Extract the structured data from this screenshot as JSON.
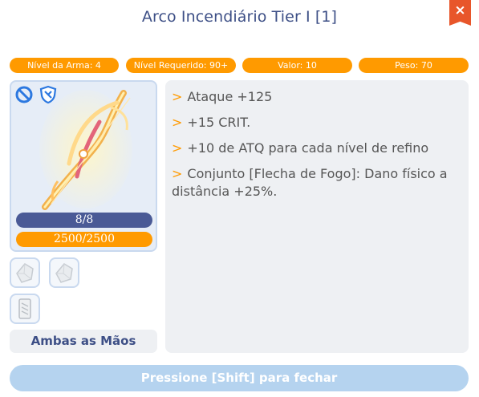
{
  "window": {
    "title": "Arco Incendiário Tier I [1]",
    "close_label": "×"
  },
  "colors": {
    "accent_orange": "#ff9a00",
    "title_blue": "#3d4f86",
    "close_red": "#e8562a",
    "durability_bar": "#4a5a96"
  },
  "stats": [
    {
      "label": "Nível da Arma: 4"
    },
    {
      "label": "Nível Requerido: 90+"
    },
    {
      "label": "Valor: 10"
    },
    {
      "label": "Peso: 70"
    }
  ],
  "item_panel": {
    "badges": [
      "no-trade-icon",
      "shield-icon"
    ],
    "image": "fire-bow-icon",
    "durability_text": "8/8",
    "exp_text": "2500/2500"
  },
  "slots": [
    {
      "icon": "crystal-slot-icon"
    },
    {
      "icon": "crystal-slot-icon"
    },
    {
      "icon": "scroll-slot-icon"
    }
  ],
  "hands_label": "Ambas as Mãos",
  "description": {
    "arrow": ">",
    "lines": [
      "Ataque +125",
      "+15 CRIT.",
      "+10 de ATQ para cada nível de refino",
      "Conjunto [Flecha de Fogo]: Dano físico a distância +25%."
    ]
  },
  "footer": {
    "close_hint": "Pressione [Shift] para fechar"
  }
}
